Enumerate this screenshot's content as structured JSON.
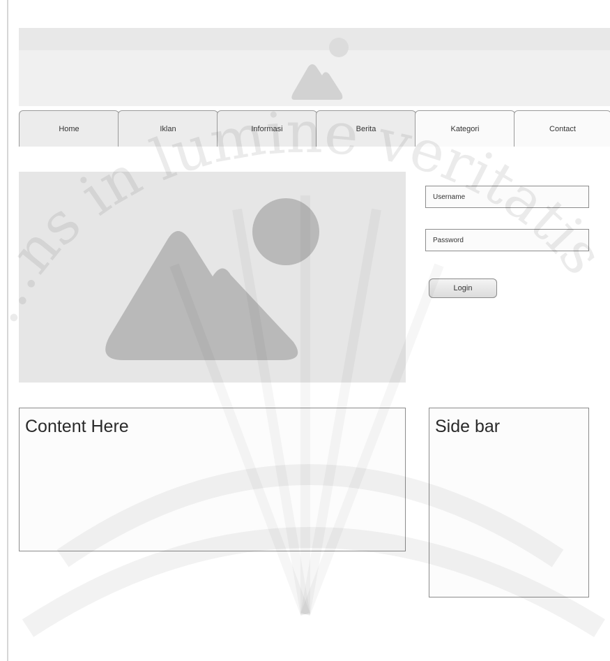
{
  "nav": {
    "tabs": [
      {
        "label": "Home"
      },
      {
        "label": "Iklan"
      },
      {
        "label": "Informasi"
      },
      {
        "label": "Berita"
      },
      {
        "label": "Kategori"
      },
      {
        "label": "Contact"
      }
    ]
  },
  "login": {
    "username_placeholder": "Username",
    "password_placeholder": "Password",
    "button_label": "Login"
  },
  "content": {
    "title": "Content Here"
  },
  "sidebar": {
    "title": "Side bar"
  },
  "watermark": {
    "text": "…ns in lumine veritatis"
  },
  "colors": {
    "placeholder_fill": "#e6e6e6",
    "placeholder_shape": "#b9b9b9",
    "border": "#8c8c8c"
  }
}
